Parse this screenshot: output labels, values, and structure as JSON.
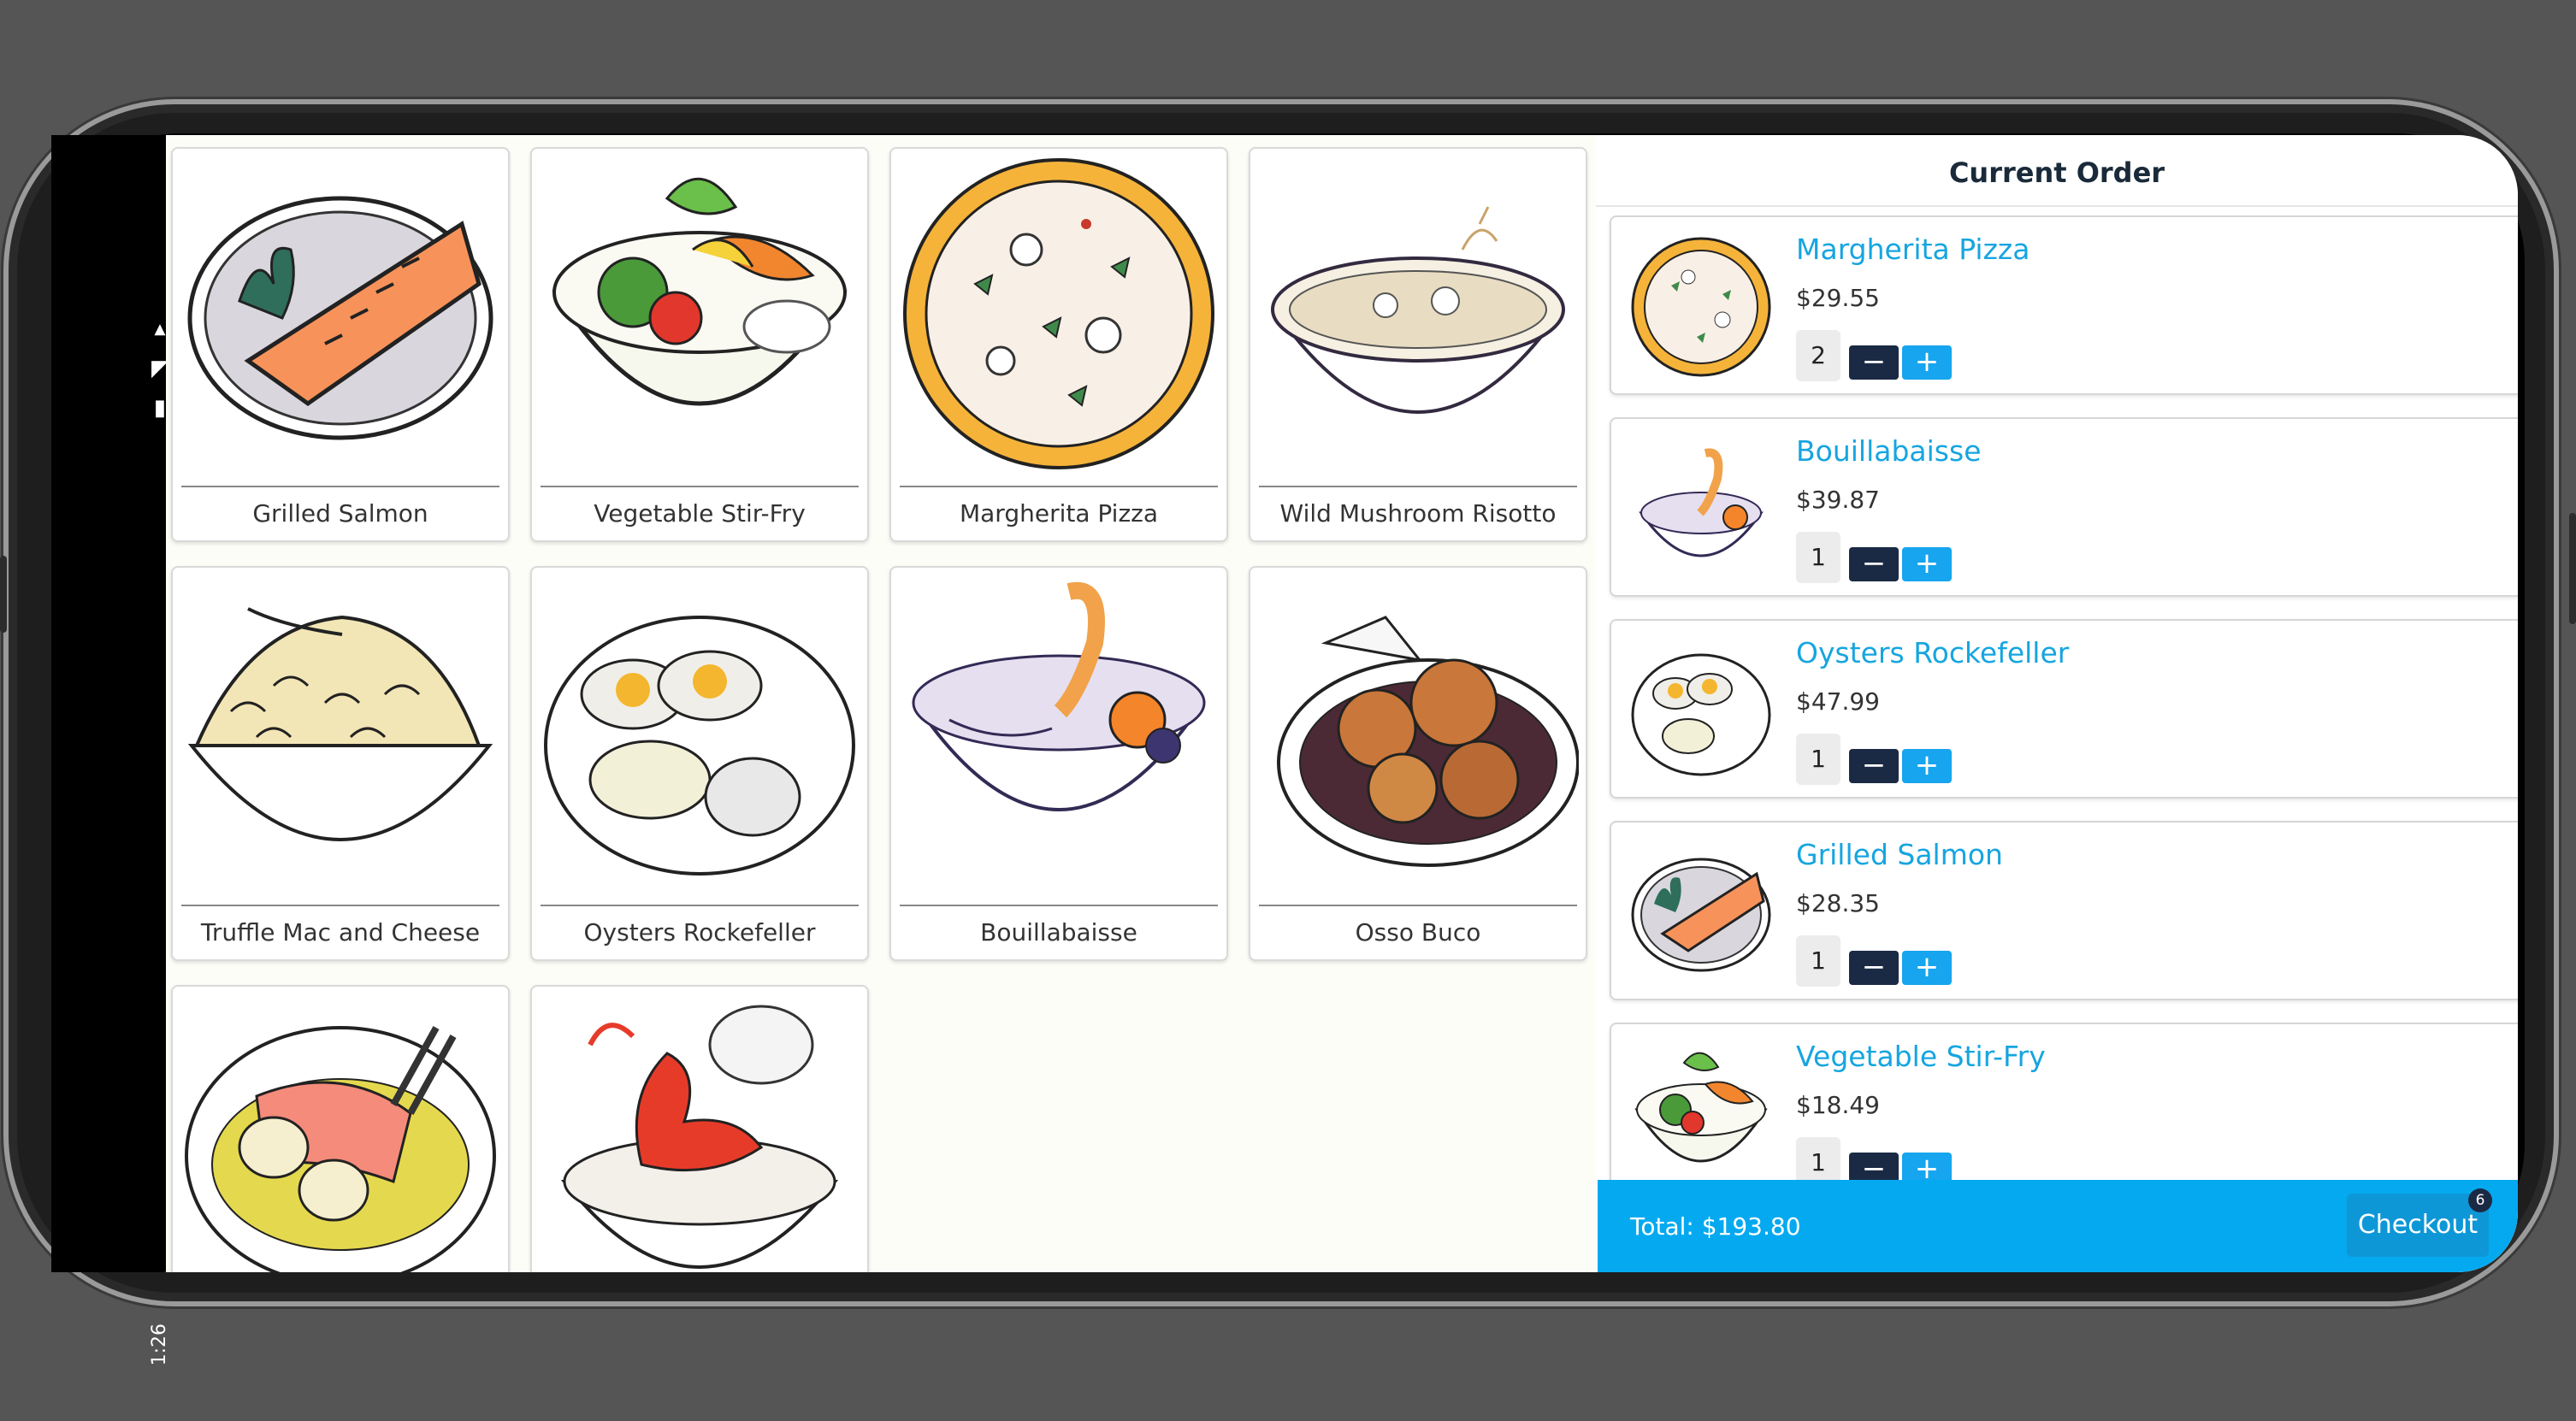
{
  "status_bar": {
    "time": "1:26",
    "icons": "▮ ◢ ▾"
  },
  "menu": {
    "items": [
      {
        "name": "Grilled Salmon"
      },
      {
        "name": "Vegetable Stir-Fry"
      },
      {
        "name": "Margherita Pizza"
      },
      {
        "name": "Wild Mushroom Risotto"
      },
      {
        "name": "Truffle Mac and Cheese"
      },
      {
        "name": "Oysters Rockefeller"
      },
      {
        "name": "Bouillabaisse"
      },
      {
        "name": "Osso Buco"
      },
      {
        "name": ""
      },
      {
        "name": ""
      }
    ]
  },
  "order": {
    "title": "Current Order",
    "items": [
      {
        "name": "Margherita Pizza",
        "price": "$29.55",
        "qty": "2"
      },
      {
        "name": "Bouillabaisse",
        "price": "$39.87",
        "qty": "1"
      },
      {
        "name": "Oysters Rockefeller",
        "price": "$47.99",
        "qty": "1"
      },
      {
        "name": "Grilled Salmon",
        "price": "$28.35",
        "qty": "1"
      },
      {
        "name": "Vegetable Stir-Fry",
        "price": "$18.49",
        "qty": "1"
      }
    ],
    "minus_label": "−",
    "plus_label": "+"
  },
  "footer": {
    "total_label": "Total:  $193.80",
    "checkout_label": "Checkout",
    "checkout_badge": "6"
  }
}
